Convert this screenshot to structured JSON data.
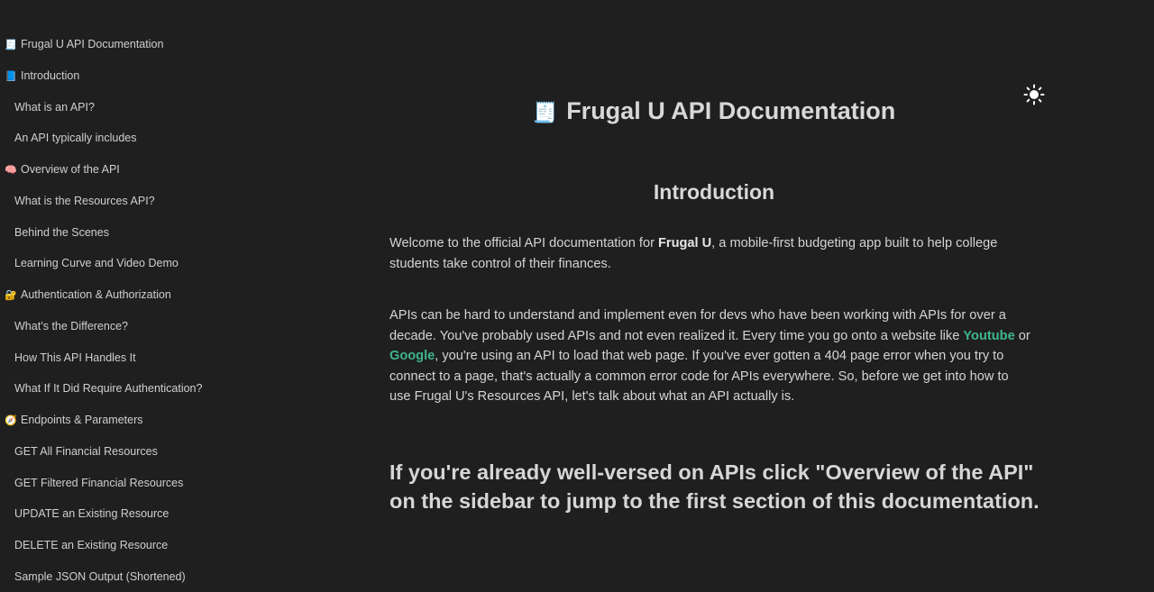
{
  "sidebar": {
    "items": [
      {
        "emoji": "🧾",
        "label": "Frugal U API Documentation",
        "level": "top"
      },
      {
        "emoji": "📘",
        "label": "Introduction",
        "level": "top"
      },
      {
        "emoji": "",
        "label": "What is an API?",
        "level": "sub"
      },
      {
        "emoji": "",
        "label": "An API typically includes",
        "level": "sub"
      },
      {
        "emoji": "🧠",
        "label": "Overview of the API",
        "level": "top"
      },
      {
        "emoji": "",
        "label": "What is the Resources API?",
        "level": "sub"
      },
      {
        "emoji": "",
        "label": "Behind the Scenes",
        "level": "sub"
      },
      {
        "emoji": "",
        "label": "Learning Curve and Video Demo",
        "level": "sub"
      },
      {
        "emoji": "🔐",
        "label": "Authentication & Authorization",
        "level": "top"
      },
      {
        "emoji": "",
        "label": "What’s the Difference?",
        "level": "sub"
      },
      {
        "emoji": "",
        "label": "How This API Handles It",
        "level": "sub"
      },
      {
        "emoji": "",
        "label": "What If It Did Require Authentication?",
        "level": "sub"
      },
      {
        "emoji": "🧭",
        "label": "Endpoints & Parameters",
        "level": "top"
      },
      {
        "emoji": "",
        "label": "GET All Financial Resources",
        "level": "sub"
      },
      {
        "emoji": "",
        "label": "GET Filtered Financial Resources",
        "level": "sub"
      },
      {
        "emoji": "",
        "label": "UPDATE an Existing Resource",
        "level": "sub"
      },
      {
        "emoji": "",
        "label": "DELETE an Existing Resource",
        "level": "sub"
      },
      {
        "emoji": "",
        "label": "Sample JSON Output (Shortened)",
        "level": "sub"
      }
    ]
  },
  "theme_toggle": {
    "icon": "sun-icon"
  },
  "main": {
    "title_emoji": "🧾",
    "title": "Frugal U API Documentation",
    "section_heading": "Introduction",
    "intro": {
      "before": "Welcome to the official API documentation for ",
      "bold": "Frugal U",
      "after": ", a mobile-first budgeting app built to help college students take control of their finances."
    },
    "apis": {
      "part1": "APIs can be hard to understand and implement even for devs who have been working with APIs for over a decade. You've probably used APIs and not even realized it. Every time you go onto a website like ",
      "link1": "Youtube",
      "part2": " or ",
      "link2": "Google",
      "part3": ", you're using an API to load that web page. If you've ever gotten a 404 page error when you try to connect to a page, that's actually a common error code for APIs everywhere. So, before we get into how to use Frugal U's Resources API, let's talk about what an API actually is."
    },
    "callout": "If you're already well-versed on APIs click \"Overview of the API\" on the sidebar to jump to the first section of this documentation."
  },
  "colors": {
    "background": "#1f1f1f",
    "text": "#d4d4d4",
    "link": "#3fb58a"
  }
}
